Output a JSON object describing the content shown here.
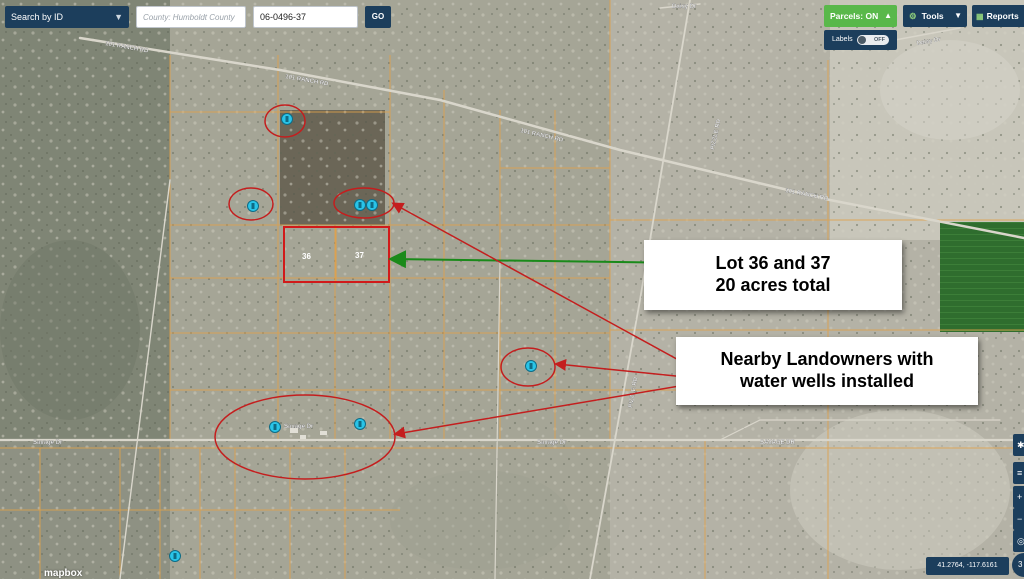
{
  "toolbar": {
    "search_mode": "Search by ID",
    "county_placeholder": "County: Humboldt County",
    "parcel_id": "06-0496-37",
    "go_label": "GO",
    "parcels_label": "Parcels:",
    "parcels_state": "ON",
    "tools_label": "Tools",
    "reports_label": "Reports",
    "labels_label": "Labels",
    "labels_state": "OFF"
  },
  "map": {
    "roads": [
      "101 RANCH RD",
      "101 RANCH RD",
      "101 RANCH RD",
      "101 RANCH RD",
      "PIZZLE RD",
      "SAVAGE DR",
      "SAVAGE DR",
      "SAVAGE DR",
      "Savage Dr",
      "Daisy Dr",
      "Daisy Dr"
    ],
    "lot_labels": [
      "36",
      "37"
    ],
    "highlight_color": "#d11a1a",
    "arrow_green": "#1a8a1a",
    "parcel_line_color": "#e0a14a",
    "well_marker_color": "#29c4e8",
    "well_marker_count": 8
  },
  "annotations": {
    "lot_line1": "Lot 36 and 37",
    "lot_line2": "20 acres total",
    "wells_line1": "Nearby Landowners with",
    "wells_line2": "water wells installed"
  },
  "controls": {
    "coordinates": "41.2764, -117.6161",
    "mode_3d": "3",
    "attribution": "mapbox"
  },
  "icons": [
    "chevron-down-icon",
    "gear-icon",
    "grid-icon",
    "water-well-icon",
    "compass-icon",
    "zoom-in-icon",
    "zoom-out-icon"
  ]
}
